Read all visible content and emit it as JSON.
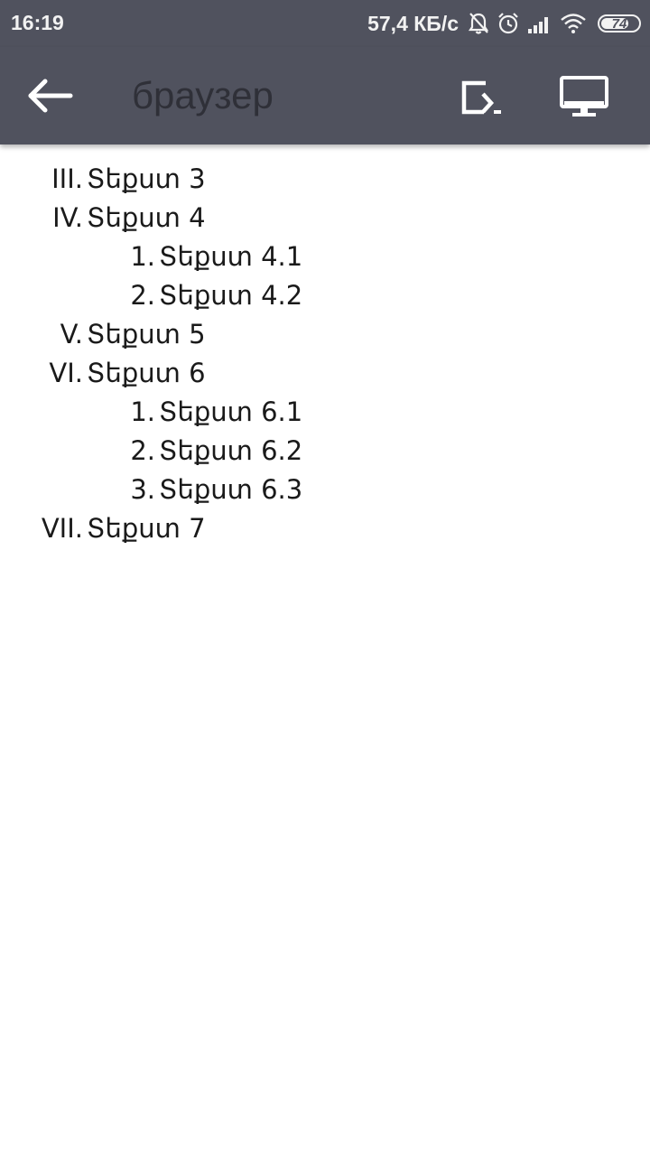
{
  "status_bar": {
    "time": "16:19",
    "net_speed": "57,4 КБ/с",
    "battery_level": "74",
    "battery_percent": 74,
    "icons": [
      "bell-muted-icon",
      "alarm-icon",
      "signal-icon",
      "wifi-icon",
      "battery-icon"
    ]
  },
  "app_bar": {
    "title": "браузер",
    "icons": [
      "arrow-left-icon",
      "open-in-icon",
      "desktop-icon"
    ]
  },
  "list": {
    "items": [
      {
        "marker": "III.",
        "text": "Տեքստ 3",
        "level": 1
      },
      {
        "marker": "IV.",
        "text": "Տեքստ 4",
        "level": 1
      },
      {
        "marker": "1.",
        "text": "Տեքստ 4.1",
        "level": 2
      },
      {
        "marker": "2.",
        "text": "Տեքստ 4.2",
        "level": 2
      },
      {
        "marker": "V.",
        "text": "Տեքստ 5",
        "level": 1
      },
      {
        "marker": "VI.",
        "text": "Տեքստ 6",
        "level": 1
      },
      {
        "marker": "1.",
        "text": "Տեքստ 6.1",
        "level": 2
      },
      {
        "marker": "2.",
        "text": "Տեքստ 6.2",
        "level": 2
      },
      {
        "marker": "3.",
        "text": "Տեքստ 6.3",
        "level": 2
      },
      {
        "marker": "VII.",
        "text": "Տեքստ 7",
        "level": 1
      }
    ]
  },
  "colors": {
    "bar_background": "#50525e",
    "title_text": "#2f3038",
    "icon_white": "#ffffff",
    "page_background": "#ffffff",
    "body_text": "#1a1a1a"
  }
}
